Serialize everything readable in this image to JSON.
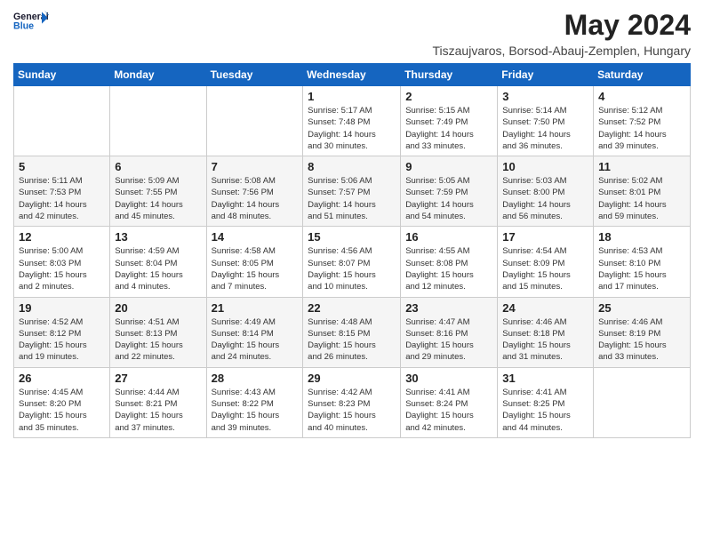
{
  "logo": {
    "line1": "General",
    "line2": "Blue"
  },
  "title": "May 2024",
  "location": "Tiszaujvaros, Borsod-Abauj-Zemplen, Hungary",
  "weekdays": [
    "Sunday",
    "Monday",
    "Tuesday",
    "Wednesday",
    "Thursday",
    "Friday",
    "Saturday"
  ],
  "weeks": [
    [
      {
        "day": "",
        "info": ""
      },
      {
        "day": "",
        "info": ""
      },
      {
        "day": "",
        "info": ""
      },
      {
        "day": "1",
        "info": "Sunrise: 5:17 AM\nSunset: 7:48 PM\nDaylight: 14 hours\nand 30 minutes."
      },
      {
        "day": "2",
        "info": "Sunrise: 5:15 AM\nSunset: 7:49 PM\nDaylight: 14 hours\nand 33 minutes."
      },
      {
        "day": "3",
        "info": "Sunrise: 5:14 AM\nSunset: 7:50 PM\nDaylight: 14 hours\nand 36 minutes."
      },
      {
        "day": "4",
        "info": "Sunrise: 5:12 AM\nSunset: 7:52 PM\nDaylight: 14 hours\nand 39 minutes."
      }
    ],
    [
      {
        "day": "5",
        "info": "Sunrise: 5:11 AM\nSunset: 7:53 PM\nDaylight: 14 hours\nand 42 minutes."
      },
      {
        "day": "6",
        "info": "Sunrise: 5:09 AM\nSunset: 7:55 PM\nDaylight: 14 hours\nand 45 minutes."
      },
      {
        "day": "7",
        "info": "Sunrise: 5:08 AM\nSunset: 7:56 PM\nDaylight: 14 hours\nand 48 minutes."
      },
      {
        "day": "8",
        "info": "Sunrise: 5:06 AM\nSunset: 7:57 PM\nDaylight: 14 hours\nand 51 minutes."
      },
      {
        "day": "9",
        "info": "Sunrise: 5:05 AM\nSunset: 7:59 PM\nDaylight: 14 hours\nand 54 minutes."
      },
      {
        "day": "10",
        "info": "Sunrise: 5:03 AM\nSunset: 8:00 PM\nDaylight: 14 hours\nand 56 minutes."
      },
      {
        "day": "11",
        "info": "Sunrise: 5:02 AM\nSunset: 8:01 PM\nDaylight: 14 hours\nand 59 minutes."
      }
    ],
    [
      {
        "day": "12",
        "info": "Sunrise: 5:00 AM\nSunset: 8:03 PM\nDaylight: 15 hours\nand 2 minutes."
      },
      {
        "day": "13",
        "info": "Sunrise: 4:59 AM\nSunset: 8:04 PM\nDaylight: 15 hours\nand 4 minutes."
      },
      {
        "day": "14",
        "info": "Sunrise: 4:58 AM\nSunset: 8:05 PM\nDaylight: 15 hours\nand 7 minutes."
      },
      {
        "day": "15",
        "info": "Sunrise: 4:56 AM\nSunset: 8:07 PM\nDaylight: 15 hours\nand 10 minutes."
      },
      {
        "day": "16",
        "info": "Sunrise: 4:55 AM\nSunset: 8:08 PM\nDaylight: 15 hours\nand 12 minutes."
      },
      {
        "day": "17",
        "info": "Sunrise: 4:54 AM\nSunset: 8:09 PM\nDaylight: 15 hours\nand 15 minutes."
      },
      {
        "day": "18",
        "info": "Sunrise: 4:53 AM\nSunset: 8:10 PM\nDaylight: 15 hours\nand 17 minutes."
      }
    ],
    [
      {
        "day": "19",
        "info": "Sunrise: 4:52 AM\nSunset: 8:12 PM\nDaylight: 15 hours\nand 19 minutes."
      },
      {
        "day": "20",
        "info": "Sunrise: 4:51 AM\nSunset: 8:13 PM\nDaylight: 15 hours\nand 22 minutes."
      },
      {
        "day": "21",
        "info": "Sunrise: 4:49 AM\nSunset: 8:14 PM\nDaylight: 15 hours\nand 24 minutes."
      },
      {
        "day": "22",
        "info": "Sunrise: 4:48 AM\nSunset: 8:15 PM\nDaylight: 15 hours\nand 26 minutes."
      },
      {
        "day": "23",
        "info": "Sunrise: 4:47 AM\nSunset: 8:16 PM\nDaylight: 15 hours\nand 29 minutes."
      },
      {
        "day": "24",
        "info": "Sunrise: 4:46 AM\nSunset: 8:18 PM\nDaylight: 15 hours\nand 31 minutes."
      },
      {
        "day": "25",
        "info": "Sunrise: 4:46 AM\nSunset: 8:19 PM\nDaylight: 15 hours\nand 33 minutes."
      }
    ],
    [
      {
        "day": "26",
        "info": "Sunrise: 4:45 AM\nSunset: 8:20 PM\nDaylight: 15 hours\nand 35 minutes."
      },
      {
        "day": "27",
        "info": "Sunrise: 4:44 AM\nSunset: 8:21 PM\nDaylight: 15 hours\nand 37 minutes."
      },
      {
        "day": "28",
        "info": "Sunrise: 4:43 AM\nSunset: 8:22 PM\nDaylight: 15 hours\nand 39 minutes."
      },
      {
        "day": "29",
        "info": "Sunrise: 4:42 AM\nSunset: 8:23 PM\nDaylight: 15 hours\nand 40 minutes."
      },
      {
        "day": "30",
        "info": "Sunrise: 4:41 AM\nSunset: 8:24 PM\nDaylight: 15 hours\nand 42 minutes."
      },
      {
        "day": "31",
        "info": "Sunrise: 4:41 AM\nSunset: 8:25 PM\nDaylight: 15 hours\nand 44 minutes."
      },
      {
        "day": "",
        "info": ""
      }
    ]
  ]
}
